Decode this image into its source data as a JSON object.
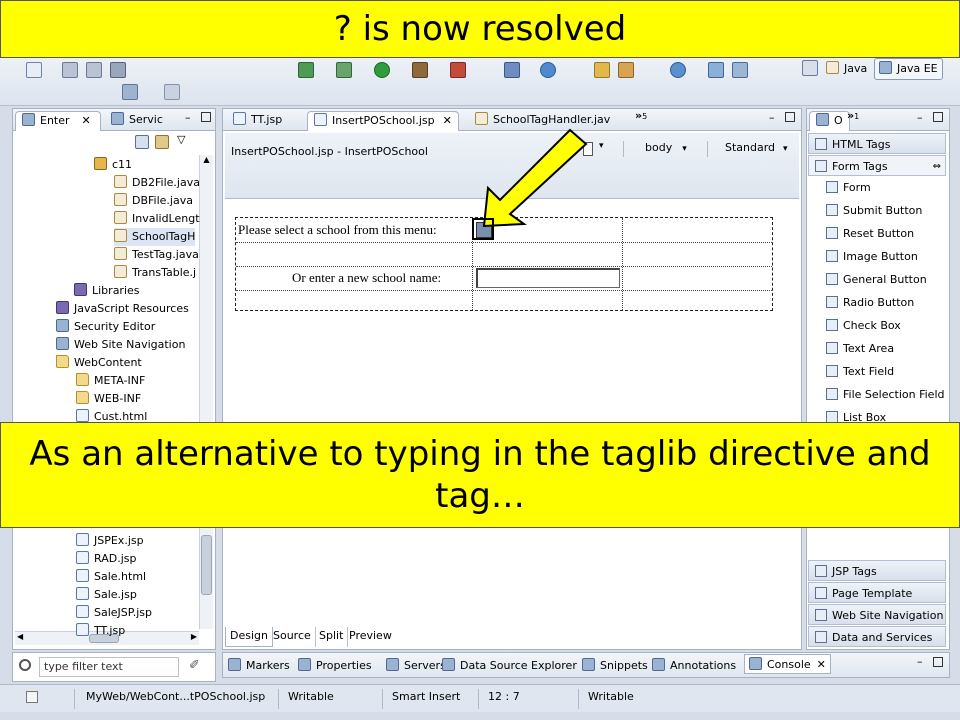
{
  "banner_top": "? is now resolved",
  "banner_middle": "As an alternative to typing in the taglib directive and tag…",
  "perspectives": [
    "Java",
    "Java EE"
  ],
  "left_panel": {
    "tabs": [
      "Enter",
      "Servic"
    ],
    "tree": [
      {
        "label": "c11",
        "icon": "package-icon"
      },
      {
        "label": "DB2File.java",
        "icon": "java-file-icon"
      },
      {
        "label": "DBFile.java",
        "icon": "java-file-icon"
      },
      {
        "label": "InvalidLengt",
        "icon": "java-file-icon"
      },
      {
        "label": "SchoolTagH",
        "icon": "java-file-icon"
      },
      {
        "label": "TestTag.java",
        "icon": "java-file-icon"
      },
      {
        "label": "TransTable.j",
        "icon": "java-file-icon"
      },
      {
        "label": "Libraries",
        "icon": "library-icon"
      },
      {
        "label": "JavaScript Resources",
        "icon": "library-icon"
      },
      {
        "label": "Security Editor",
        "icon": "security-icon"
      },
      {
        "label": "Web Site Navigation",
        "icon": "navigation-icon"
      },
      {
        "label": "WebContent",
        "icon": "folder-icon"
      },
      {
        "label": "META-INF",
        "icon": "folder-icon"
      },
      {
        "label": "WEB-INF",
        "icon": "folder-icon"
      },
      {
        "label": "Cust.html",
        "icon": "file-icon"
      },
      {
        "label": "JSPEx.jsp",
        "icon": "file-icon"
      },
      {
        "label": "RAD.jsp",
        "icon": "file-icon"
      },
      {
        "label": "Sale.html",
        "icon": "file-icon"
      },
      {
        "label": "Sale.jsp",
        "icon": "file-icon"
      },
      {
        "label": "SaleJSP.jsp",
        "icon": "file-icon"
      },
      {
        "label": "TT.jsp",
        "icon": "file-icon"
      }
    ],
    "filter_placeholder": "type filter text"
  },
  "editor": {
    "tabs": [
      "TT.jsp",
      "InsertPOSchool.jsp",
      "SchoolTagHandler.jav"
    ],
    "overflow_count": "5",
    "breadcrumb": "InsertPOSchool.jsp - InsertPOSchool",
    "body_select": "body",
    "mode_select": "Standard",
    "form_label_1": "Please select a school from this menu:",
    "form_label_2": "Or enter a new school name:",
    "bottom_tabs": [
      "Design",
      "Source",
      "Split",
      "Preview"
    ]
  },
  "right_panel": {
    "tabs": [
      "O",
      "1"
    ],
    "html_tags_header": "HTML Tags",
    "form_tags_header": "Form Tags",
    "items": [
      "Form",
      "Submit Button",
      "Reset Button",
      "Image Button",
      "General Button",
      "Radio Button",
      "Check Box",
      "Text Area",
      "Text Field",
      "File Selection Field",
      "List Box"
    ],
    "drawers": [
      "JSP Tags",
      "Page Template",
      "Web Site Navigation",
      "Data and Services"
    ]
  },
  "bottom_views": [
    "Markers",
    "Properties",
    "Servers",
    "Data Source Explorer",
    "Snippets",
    "Annotations",
    "Console"
  ],
  "status_bar": {
    "path": "MyWeb/WebCont...tPOSchool.jsp",
    "state": "Writable",
    "insert_mode": "Smart Insert",
    "position": "12 : 7",
    "state2": "Writable"
  },
  "colors": {
    "banner": "#ffff00",
    "arrow": "#ffff00",
    "chrome": "#d6dde8"
  }
}
